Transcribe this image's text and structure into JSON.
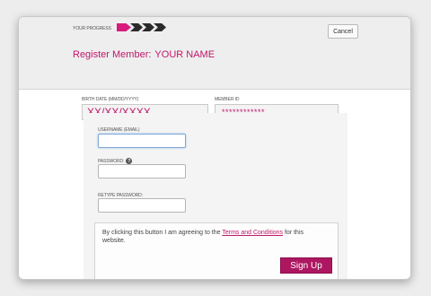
{
  "header": {
    "progress_label": "YOUR PROGRESS",
    "progress_steps_completed": 1,
    "progress_steps_total": 4,
    "cancel_label": "Cancel",
    "title_prefix": "Register Member:",
    "title_name": "YOUR NAME"
  },
  "fields": {
    "birth_date": {
      "label": "BIRTH DATE (MM/DD/YYYY)",
      "value": "XX/XX/XXXX"
    },
    "member_id": {
      "label": "MEMBER ID",
      "value": "************"
    }
  },
  "form": {
    "username": {
      "label": "USERNAME (EMAIL)",
      "value": ""
    },
    "password": {
      "label": "PASSWORD:",
      "help_icon": "?",
      "value": ""
    },
    "retype_password": {
      "label": "RETYPE PASSWORD:",
      "value": ""
    }
  },
  "terms": {
    "text_before": "By clicking this button I am agreeing to the ",
    "link": "Terms and Conditions",
    "text_after": " for this website.",
    "signup_label": "Sign Up"
  },
  "colors": {
    "accent": "#c0176a",
    "progress_active": "#d81b7d",
    "progress_inactive": "#2b2b2b",
    "signup_button": "#ad1761"
  }
}
